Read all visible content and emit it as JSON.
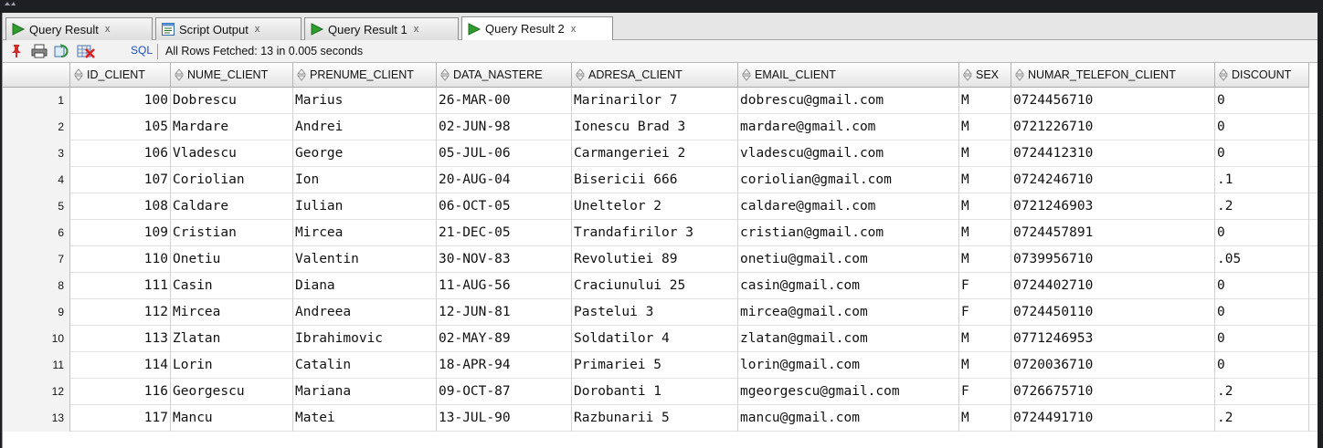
{
  "tabs": [
    {
      "label": "Query Result",
      "icon": "play-icon",
      "active": false
    },
    {
      "label": "Script Output",
      "icon": "script-icon",
      "active": false
    },
    {
      "label": "Query Result 1",
      "icon": "play-icon",
      "active": false
    },
    {
      "label": "Query Result 2",
      "icon": "play-icon",
      "active": true
    }
  ],
  "tab_close_glyph": "x",
  "toolbar": {
    "icons": [
      "pin-icon",
      "print-icon",
      "refresh-icon",
      "delete-icon"
    ],
    "sql_label": "SQL",
    "status": "All Rows Fetched: 13 in 0.005 seconds"
  },
  "columns": [
    "ID_CLIENT",
    "NUME_CLIENT",
    "PRENUME_CLIENT",
    "DATA_NASTERE",
    "ADRESA_CLIENT",
    "EMAIL_CLIENT",
    "SEX",
    "NUMAR_TELEFON_CLIENT",
    "DISCOUNT"
  ],
  "rows": [
    {
      "n": "1",
      "cells": [
        "100",
        "Dobrescu",
        "Marius",
        "26-MAR-00",
        "Marinarilor 7",
        "dobrescu@gmail.com",
        "M",
        "0724456710",
        "0"
      ]
    },
    {
      "n": "2",
      "cells": [
        "105",
        "Mardare",
        "Andrei",
        "02-JUN-98",
        "Ionescu Brad 3",
        "mardare@gmail.com",
        "M",
        "0721226710",
        "0"
      ]
    },
    {
      "n": "3",
      "cells": [
        "106",
        "Vladescu",
        "George",
        "05-JUL-06",
        "Carmangeriei 2",
        "vladescu@gmail.com",
        "M",
        "0724412310",
        "0"
      ]
    },
    {
      "n": "4",
      "cells": [
        "107",
        "Coriolian",
        "Ion",
        "20-AUG-04",
        "Bisericii 666",
        "coriolian@gmail.com",
        "M",
        "0724246710",
        ".1"
      ]
    },
    {
      "n": "5",
      "cells": [
        "108",
        "Caldare",
        "Iulian",
        "06-OCT-05",
        "Uneltelor 2",
        "caldare@gmail.com",
        "M",
        "0721246903",
        ".2"
      ]
    },
    {
      "n": "6",
      "cells": [
        "109",
        "Cristian",
        "Mircea",
        "21-DEC-05",
        "Trandafirilor 3",
        "cristian@gmail.com",
        "M",
        "0724457891",
        "0"
      ]
    },
    {
      "n": "7",
      "cells": [
        "110",
        "Onetiu",
        "Valentin",
        "30-NOV-83",
        "Revolutiei 89",
        "onetiu@gmail.com",
        "M",
        "0739956710",
        ".05"
      ]
    },
    {
      "n": "8",
      "cells": [
        "111",
        "Casin",
        "Diana",
        "11-AUG-56",
        "Craciunului 25",
        "casin@gmail.com",
        "F",
        "0724402710",
        "0"
      ]
    },
    {
      "n": "9",
      "cells": [
        "112",
        "Mircea",
        "Andreea",
        "12-JUN-81",
        "Pastelui 3",
        "mircea@gmail.com",
        "F",
        "0724450110",
        "0"
      ]
    },
    {
      "n": "10",
      "cells": [
        "113",
        "Zlatan",
        "Ibrahimovic",
        "02-MAY-89",
        "Soldatilor 4",
        "zlatan@gmail.com",
        "M",
        "0771246953",
        "0"
      ]
    },
    {
      "n": "11",
      "cells": [
        "114",
        "Lorin",
        "Catalin",
        "18-APR-94",
        "Primariei 5",
        "lorin@gmail.com",
        "M",
        "0720036710",
        "0"
      ]
    },
    {
      "n": "12",
      "cells": [
        "116",
        "Georgescu",
        "Mariana",
        "09-OCT-87",
        "Dorobanti 1",
        "mgeorgescu@gmail.com",
        "F",
        "0726675710",
        ".2"
      ]
    },
    {
      "n": "13",
      "cells": [
        "117",
        "Mancu",
        "Matei",
        "13-JUL-90",
        "Razbunarii 5",
        "mancu@gmail.com",
        "M",
        "0724491710",
        ".2"
      ]
    }
  ],
  "colors": {
    "play": "#2e9d2e",
    "selection_blue": "#1f4fbf"
  }
}
